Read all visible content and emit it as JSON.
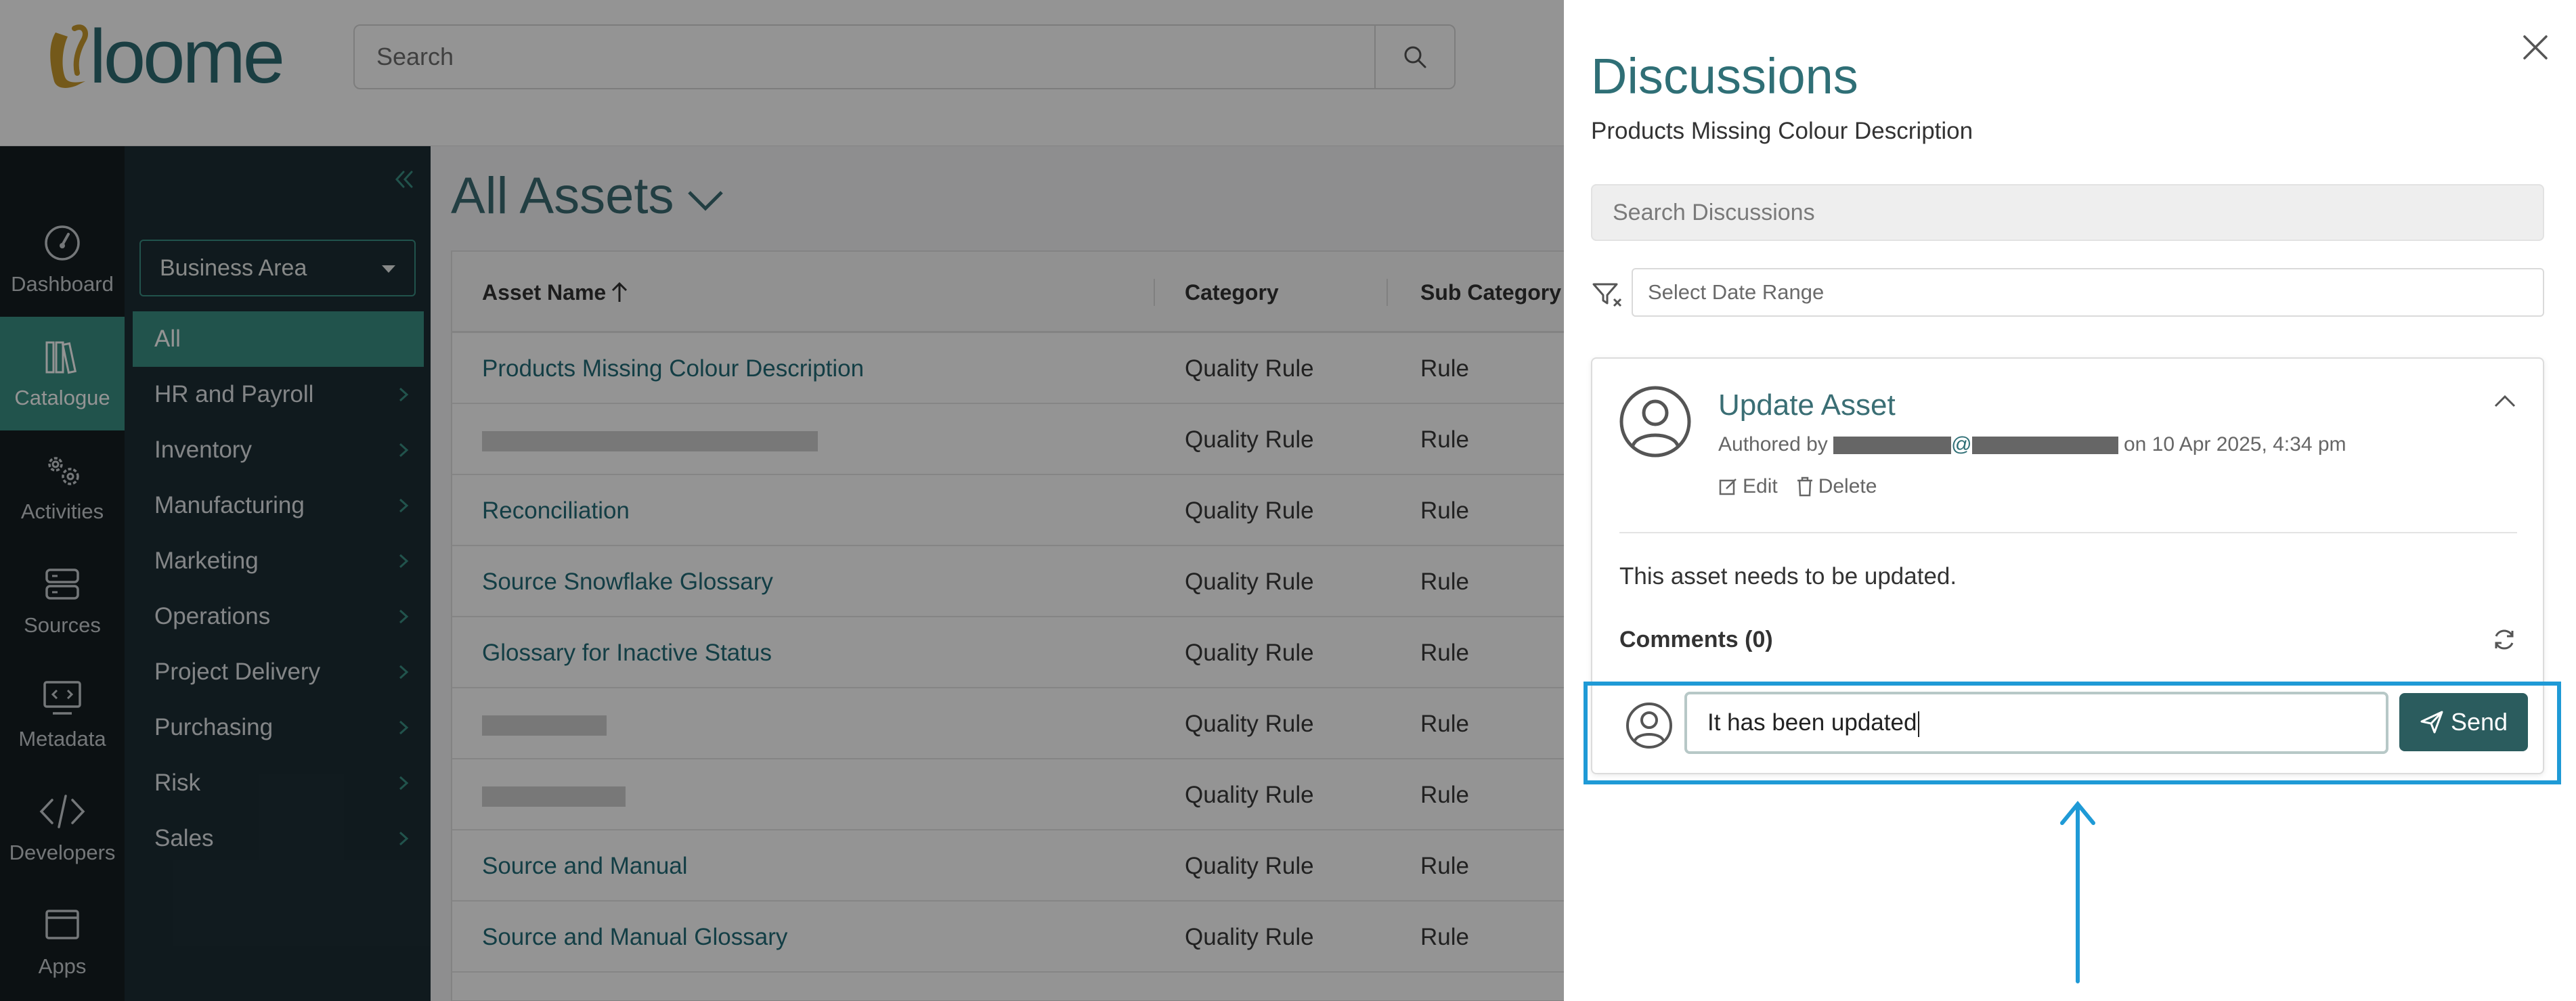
{
  "header": {
    "logo_text": "loome",
    "search_placeholder": "Search"
  },
  "rail": {
    "items": [
      {
        "label": "Dashboard",
        "icon": "dashboard-icon"
      },
      {
        "label": "Catalogue",
        "icon": "catalogue-icon",
        "active": true
      },
      {
        "label": "Activities",
        "icon": "gears-icon"
      },
      {
        "label": "Sources",
        "icon": "database-icon"
      },
      {
        "label": "Metadata",
        "icon": "metadata-icon"
      },
      {
        "label": "Developers",
        "icon": "code-icon"
      },
      {
        "label": "Apps",
        "icon": "apps-icon"
      }
    ]
  },
  "categories": {
    "dropdown_label": "Business Area",
    "items": [
      {
        "label": "All",
        "active": true
      },
      {
        "label": "HR and Payroll"
      },
      {
        "label": "Inventory"
      },
      {
        "label": "Manufacturing"
      },
      {
        "label": "Marketing"
      },
      {
        "label": "Operations"
      },
      {
        "label": "Project Delivery"
      },
      {
        "label": "Purchasing"
      },
      {
        "label": "Risk"
      },
      {
        "label": "Sales"
      }
    ]
  },
  "main": {
    "title": "All Assets",
    "columns": {
      "name": "Asset Name",
      "category": "Category",
      "sub_category": "Sub Category"
    },
    "rows": [
      {
        "name": "Products Missing Colour Description",
        "category": "Quality Rule",
        "sub_category": "Rule"
      },
      {
        "name": "",
        "category": "Quality Rule",
        "sub_category": "Rule"
      },
      {
        "name": "Reconciliation",
        "category": "Quality Rule",
        "sub_category": "Rule"
      },
      {
        "name": "Source Snowflake Glossary",
        "category": "Quality Rule",
        "sub_category": "Rule"
      },
      {
        "name": "Glossary for Inactive Status",
        "category": "Quality Rule",
        "sub_category": "Rule"
      },
      {
        "name": "",
        "category": "Quality Rule",
        "sub_category": "Rule"
      },
      {
        "name": "",
        "category": "Quality Rule",
        "sub_category": "Rule"
      },
      {
        "name": "Source and Manual",
        "category": "Quality Rule",
        "sub_category": "Rule"
      },
      {
        "name": "Source and Manual Glossary",
        "category": "Quality Rule",
        "sub_category": "Rule"
      }
    ]
  },
  "discussions": {
    "title": "Discussions",
    "asset_name": "Products Missing Colour Description",
    "search_placeholder": "Search Discussions",
    "date_placeholder": "Select Date Range",
    "post": {
      "title": "Update Asset",
      "authored_prefix": "Authored by",
      "at_sign": "@",
      "authored_suffix": "on 10 Apr 2025, 4:34 pm",
      "edit_label": "Edit",
      "delete_label": "Delete",
      "body": "This asset needs to be updated.",
      "comments_label": "Comments (0)"
    },
    "reply": {
      "value": "It has been updated",
      "send_label": "Send"
    }
  },
  "colors": {
    "accent": "#3a8f84",
    "title_teal": "#2f6f76",
    "send_button": "#2b5c5e",
    "highlight": "#1f9ad6"
  }
}
